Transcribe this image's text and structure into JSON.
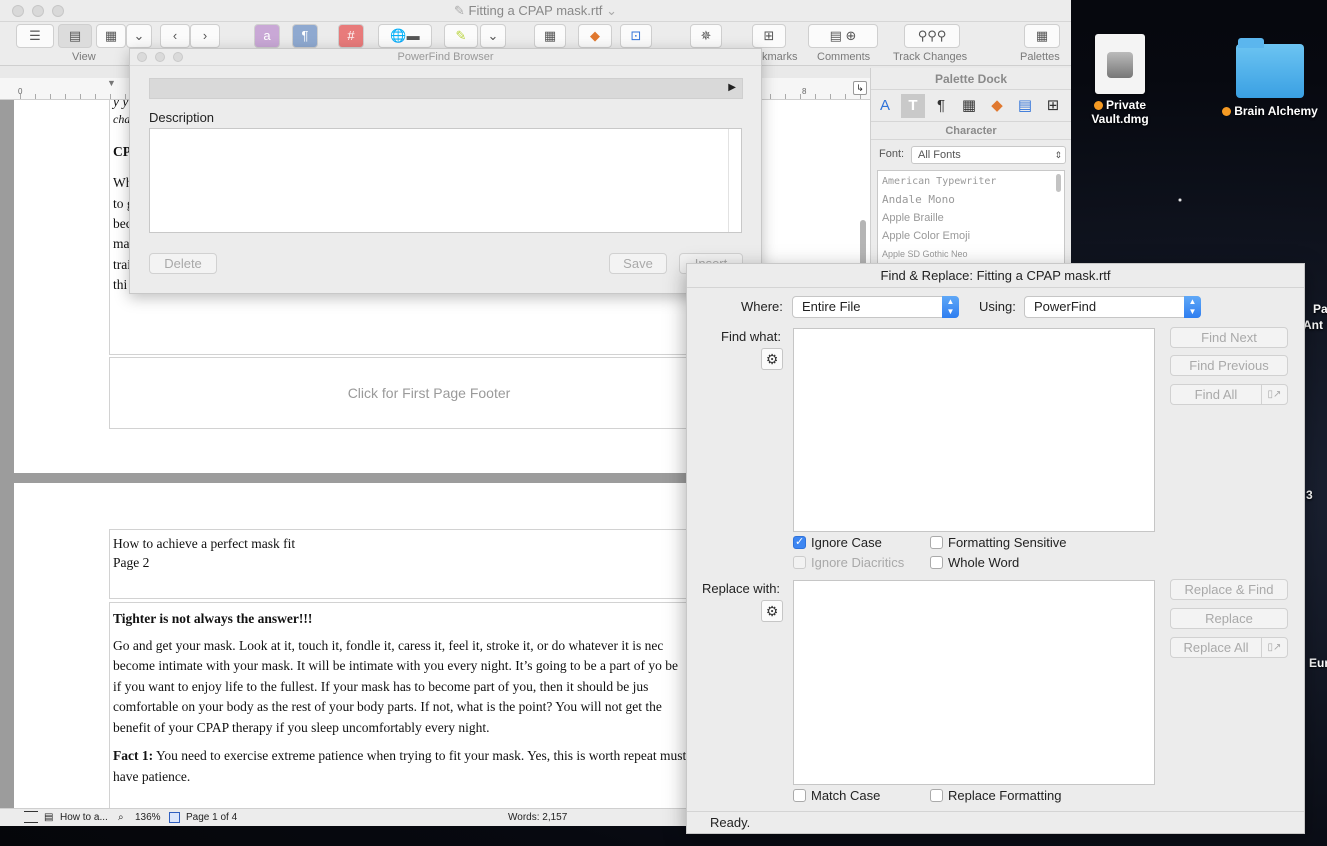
{
  "desktop": {
    "icons": [
      {
        "label_line1": "Private",
        "label_line2": "Vault.dmg",
        "icon": "disk-image-icon"
      },
      {
        "label": "Brain Alchemy",
        "icon": "folder-icon",
        "tag_color": "#f59a23"
      }
    ],
    "edge_labels": [
      "Pa",
      "Ant",
      "3",
      "Eur"
    ]
  },
  "main_window": {
    "title": "Fitting a CPAP mask.rtf",
    "title_chevron": "⌄",
    "toolbar": {
      "view_label": "View",
      "bookmarks_label": "kmarks",
      "comments_label": "Comments",
      "track_changes_label": "Track Changes",
      "palettes_label": "Palettes"
    },
    "ruler": {
      "start": "0",
      "end": "8"
    },
    "page1": {
      "fragments": [
        "y y",
        "char",
        "CP",
        "Wh",
        "to g",
        "bec",
        "ma",
        "trai",
        "thi"
      ],
      "footer_placeholder": "Click for First Page Footer"
    },
    "page2": {
      "header_line1": "How to achieve a perfect mask fit",
      "header_line2": "Page 2",
      "heading": "Tighter is not always the answer!!!",
      "para1": "Go and get your mask. Look at it, touch it, fondle it, caress it, feel it, stroke it, or do whatever it is nec become intimate with your mask. It will be intimate with you every night. It’s going to be a part of yo be if you want to enjoy life to the fullest. If your mask has to become part of you, then it should be jus comfortable on your body as the rest of your body parts. If not, what is the point? You will not get the benefit of your CPAP therapy if you sleep uncomfortably every night.",
      "fact_label": "Fact 1:",
      "fact_text": " You need to exercise extreme patience when trying to fit your mask. Yes, this is worth repeat must have patience."
    },
    "status": {
      "doc_name": "How to a...",
      "zoom": "136%",
      "page": "Page 1 of 4",
      "words": "Words: 2,157"
    }
  },
  "palette_dock": {
    "title": "Palette Dock",
    "section": "Character",
    "font_label": "Font:",
    "font_value": "All Fonts",
    "fonts": [
      "American Typewriter",
      "Andale Mono",
      "Apple Braille",
      "Apple Color Emoji",
      "Apple SD Gothic Neo"
    ]
  },
  "powerfind": {
    "title": "PowerFind Browser",
    "description_label": "Description",
    "delete_label": "Delete",
    "save_label": "Save",
    "insert_label": "Insert"
  },
  "find_replace": {
    "title": "Find & Replace: Fitting a CPAP mask.rtf",
    "where_label": "Where:",
    "where_value": "Entire File",
    "using_label": "Using:",
    "using_value": "PowerFind",
    "find_label": "Find what:",
    "replace_label": "Replace with:",
    "find_next": "Find Next",
    "find_previous": "Find Previous",
    "find_all": "Find All",
    "replace_and_find": "Replace & Find",
    "replace": "Replace",
    "replace_all": "Replace All",
    "ignore_case": "Ignore Case",
    "ignore_diacritics": "Ignore Diacritics",
    "formatting_sensitive": "Formatting Sensitive",
    "whole_word": "Whole Word",
    "match_case": "Match Case",
    "replace_formatting": "Replace Formatting",
    "status": "Ready."
  }
}
